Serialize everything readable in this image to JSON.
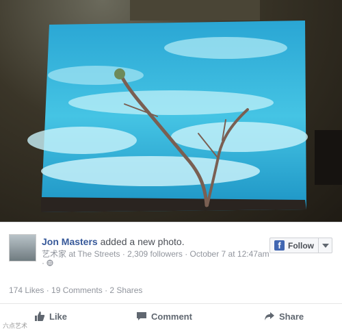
{
  "post": {
    "author": "Jon Masters",
    "action": "added a new photo.",
    "meta": "艺术家 at The Streets · 2,309 followers · October 7 at 12:47am",
    "meta_extra": "·",
    "follow_label": "Follow",
    "stats": "174 Likes · 19 Comments · 2 Shares",
    "actions": {
      "like": "Like",
      "comment": "Comment",
      "share": "Share"
    },
    "watermark": "六点艺术"
  },
  "colors": {
    "link": "#365899",
    "fb_blue": "#4267b2",
    "sky": "#2bb0d6"
  }
}
